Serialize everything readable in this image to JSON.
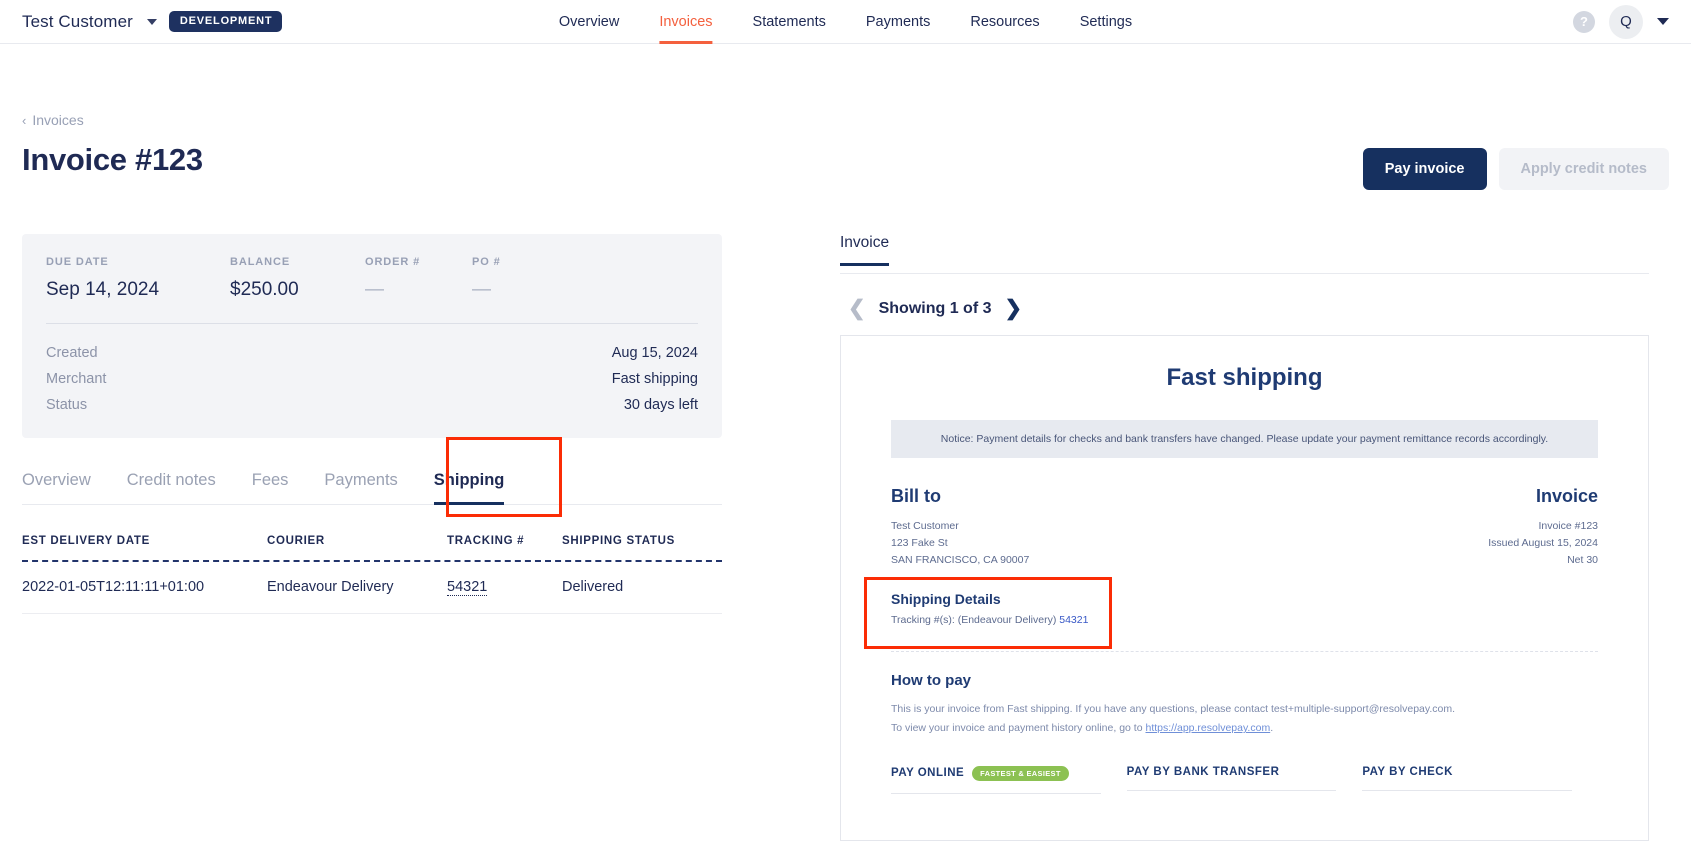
{
  "topnav": {
    "brand": "Test Customer",
    "env_badge": "DEVELOPMENT",
    "tabs": [
      {
        "label": "Overview",
        "active": false
      },
      {
        "label": "Invoices",
        "active": true
      },
      {
        "label": "Statements",
        "active": false
      },
      {
        "label": "Payments",
        "active": false
      },
      {
        "label": "Resources",
        "active": false
      },
      {
        "label": "Settings",
        "active": false
      }
    ],
    "help_glyph": "?",
    "avatar_initial": "Q",
    "accent_color": "#f4603e",
    "badge_color": "#1e3160"
  },
  "breadcrumb": {
    "chevron": "‹",
    "label": "Invoices"
  },
  "header": {
    "title": "Invoice #123",
    "pay_button": "Pay invoice",
    "credit_button": "Apply credit notes"
  },
  "summary": {
    "metrics": [
      {
        "label": "DUE DATE",
        "value": "Sep 14, 2024",
        "dash": false
      },
      {
        "label": "BALANCE",
        "value": "$250.00",
        "dash": false
      },
      {
        "label": "ORDER #",
        "value": "—",
        "dash": true
      },
      {
        "label": "PO #",
        "value": "—",
        "dash": true
      }
    ],
    "rows": [
      {
        "key": "Created",
        "value": "Aug 15, 2024"
      },
      {
        "key": "Merchant",
        "value": "Fast shipping"
      },
      {
        "key": "Status",
        "value": "30 days left"
      }
    ]
  },
  "subtabs": [
    {
      "label": "Overview",
      "active": false
    },
    {
      "label": "Credit notes",
      "active": false
    },
    {
      "label": "Fees",
      "active": false
    },
    {
      "label": "Payments",
      "active": false
    },
    {
      "label": "Shipping",
      "active": true
    }
  ],
  "shipping_table": {
    "columns": [
      "EST DELIVERY DATE",
      "COURIER",
      "TRACKING #",
      "SHIPPING STATUS"
    ],
    "rows": [
      {
        "est_delivery_date": "2022-01-05T12:11:11+01:00",
        "courier": "Endeavour Delivery",
        "tracking": "54321",
        "status": "Delivered"
      }
    ]
  },
  "right": {
    "tab_label": "Invoice",
    "pager": {
      "prev": "❮",
      "text": "Showing 1 of 3",
      "next": "❯"
    }
  },
  "document": {
    "merchant_title": "Fast shipping",
    "notice": "Notice: Payment details for checks and bank transfers have changed. Please update your payment remittance records accordingly.",
    "bill_to_heading": "Bill to",
    "bill_to_lines": [
      "Test Customer",
      "123 Fake St",
      "SAN FRANCISCO, CA 90007"
    ],
    "invoice_heading": "Invoice",
    "invoice_lines": [
      "Invoice #123",
      "Issued August 15, 2024",
      "Net 30"
    ],
    "shipping_details_heading": "Shipping Details",
    "shipping_details_prefix": "Tracking #(s): (Endeavour Delivery) ",
    "shipping_details_number": "54321",
    "how_to_pay_heading": "How to pay",
    "how_to_pay_line1": "This is your invoice from Fast shipping. If you have any questions, please contact test+multiple-support@resolvepay.com.",
    "how_to_pay_line2_pre": "To view your invoice and payment history online, go to ",
    "how_to_pay_link": "https://app.resolvepay.com",
    "how_to_pay_line2_post": ".",
    "pay_columns": [
      {
        "label": "PAY ONLINE",
        "badge": "FASTEST & EASIEST"
      },
      {
        "label": "PAY BY BANK TRANSFER",
        "badge": ""
      },
      {
        "label": "PAY BY CHECK",
        "badge": ""
      }
    ]
  },
  "highlights": {
    "color": "#fb2c05"
  }
}
